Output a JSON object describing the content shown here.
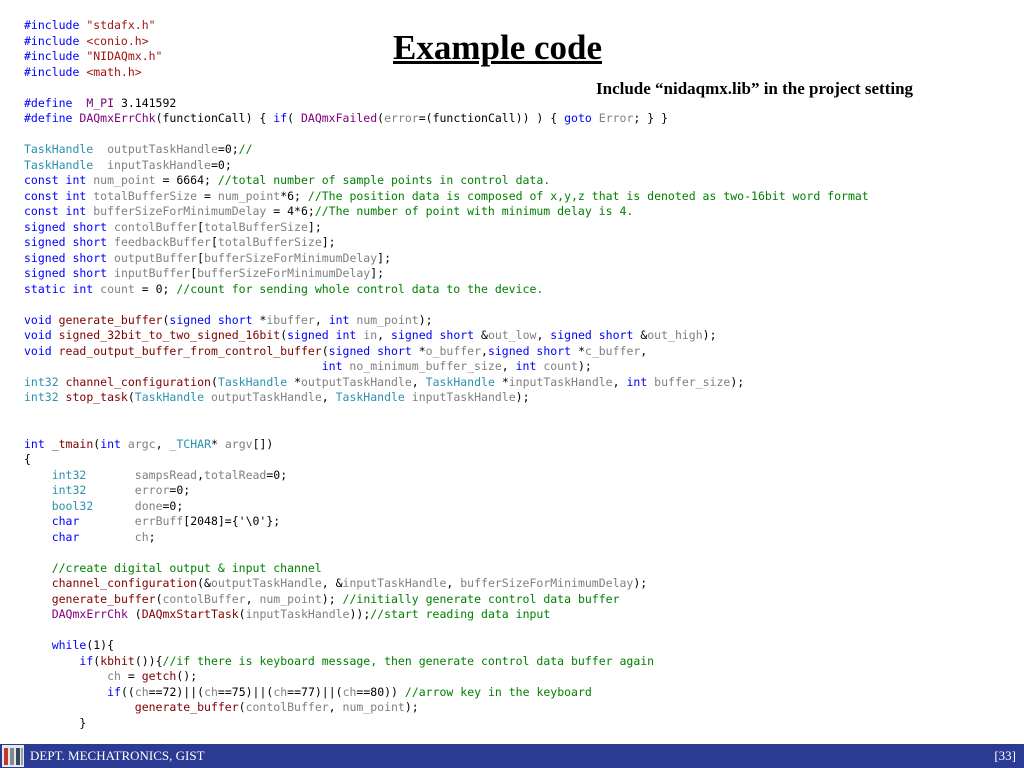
{
  "slide": {
    "title": "Example code",
    "subtitle": "Include “nidaqmx.lib” in the project setting"
  },
  "code": {
    "lines": [
      [
        {
          "t": "#include ",
          "c": "kw"
        },
        {
          "t": "\"stdafx.h\"",
          "c": "str"
        }
      ],
      [
        {
          "t": "#include ",
          "c": "kw"
        },
        {
          "t": "<conio.h>",
          "c": "str"
        }
      ],
      [
        {
          "t": "#include ",
          "c": "kw"
        },
        {
          "t": "\"NIDAQmx.h\"",
          "c": "str"
        }
      ],
      [
        {
          "t": "#include ",
          "c": "kw"
        },
        {
          "t": "<math.h>",
          "c": "str"
        }
      ],
      [],
      [
        {
          "t": "#define  ",
          "c": "kw"
        },
        {
          "t": "M_PI",
          "c": "mac"
        },
        {
          "t": " 3.141592",
          "c": ""
        }
      ],
      [
        {
          "t": "#define ",
          "c": "kw"
        },
        {
          "t": "DAQmxErrChk",
          "c": "mac"
        },
        {
          "t": "(functionCall) { ",
          "c": ""
        },
        {
          "t": "if",
          "c": "kw"
        },
        {
          "t": "( ",
          "c": ""
        },
        {
          "t": "DAQmxFailed",
          "c": "mac"
        },
        {
          "t": "(",
          "c": ""
        },
        {
          "t": "error",
          "c": "vr"
        },
        {
          "t": "=(functionCall)) ) { ",
          "c": ""
        },
        {
          "t": "goto",
          "c": "kw"
        },
        {
          "t": " ",
          "c": ""
        },
        {
          "t": "Error",
          "c": "vr"
        },
        {
          "t": "; } }",
          "c": ""
        }
      ],
      [],
      [
        {
          "t": "TaskHandle",
          "c": "tp"
        },
        {
          "t": "  ",
          "c": ""
        },
        {
          "t": "outputTaskHandle",
          "c": "vr"
        },
        {
          "t": "=0;",
          "c": ""
        },
        {
          "t": "//",
          "c": "cm"
        }
      ],
      [
        {
          "t": "TaskHandle",
          "c": "tp"
        },
        {
          "t": "  ",
          "c": ""
        },
        {
          "t": "inputTaskHandle",
          "c": "vr"
        },
        {
          "t": "=0;",
          "c": ""
        }
      ],
      [
        {
          "t": "const int ",
          "c": "kw"
        },
        {
          "t": "num_point",
          "c": "vr"
        },
        {
          "t": " = 6664; ",
          "c": ""
        },
        {
          "t": "//total number of sample points in control data.",
          "c": "cm"
        }
      ],
      [
        {
          "t": "const int ",
          "c": "kw"
        },
        {
          "t": "totalBufferSize",
          "c": "vr"
        },
        {
          "t": " = ",
          "c": ""
        },
        {
          "t": "num_point",
          "c": "vr"
        },
        {
          "t": "*6; ",
          "c": ""
        },
        {
          "t": "//The position data is composed of x,y,z that is denoted as two-16bit word format",
          "c": "cm"
        }
      ],
      [
        {
          "t": "const int ",
          "c": "kw"
        },
        {
          "t": "bufferSizeForMinimumDelay",
          "c": "vr"
        },
        {
          "t": " = 4*6;",
          "c": ""
        },
        {
          "t": "//The number of point with minimum delay is 4.",
          "c": "cm"
        }
      ],
      [
        {
          "t": "signed short ",
          "c": "kw"
        },
        {
          "t": "contolBuffer",
          "c": "vr"
        },
        {
          "t": "[",
          "c": ""
        },
        {
          "t": "totalBufferSize",
          "c": "vr"
        },
        {
          "t": "];",
          "c": ""
        }
      ],
      [
        {
          "t": "signed short ",
          "c": "kw"
        },
        {
          "t": "feedbackBuffer",
          "c": "vr"
        },
        {
          "t": "[",
          "c": ""
        },
        {
          "t": "totalBufferSize",
          "c": "vr"
        },
        {
          "t": "];",
          "c": ""
        }
      ],
      [
        {
          "t": "signed short ",
          "c": "kw"
        },
        {
          "t": "outputBuffer",
          "c": "vr"
        },
        {
          "t": "[",
          "c": ""
        },
        {
          "t": "bufferSizeForMinimumDelay",
          "c": "vr"
        },
        {
          "t": "];",
          "c": ""
        }
      ],
      [
        {
          "t": "signed short ",
          "c": "kw"
        },
        {
          "t": "inputBuffer",
          "c": "vr"
        },
        {
          "t": "[",
          "c": ""
        },
        {
          "t": "bufferSizeForMinimumDelay",
          "c": "vr"
        },
        {
          "t": "];",
          "c": ""
        }
      ],
      [
        {
          "t": "static int ",
          "c": "kw"
        },
        {
          "t": "count",
          "c": "vr"
        },
        {
          "t": " = 0; ",
          "c": ""
        },
        {
          "t": "//count for sending whole control data to the device.",
          "c": "cm"
        }
      ],
      [],
      [
        {
          "t": "void ",
          "c": "kw"
        },
        {
          "t": "generate_buffer",
          "c": "fn"
        },
        {
          "t": "(",
          "c": ""
        },
        {
          "t": "signed short ",
          "c": "kw"
        },
        {
          "t": "*",
          "c": ""
        },
        {
          "t": "ibuffer",
          "c": "vr"
        },
        {
          "t": ", ",
          "c": ""
        },
        {
          "t": "int ",
          "c": "kw"
        },
        {
          "t": "num_point",
          "c": "vr"
        },
        {
          "t": ");",
          "c": ""
        }
      ],
      [
        {
          "t": "void ",
          "c": "kw"
        },
        {
          "t": "signed_32bit_to_two_signed_16bit",
          "c": "fn"
        },
        {
          "t": "(",
          "c": ""
        },
        {
          "t": "signed int ",
          "c": "kw"
        },
        {
          "t": "in",
          "c": "vr"
        },
        {
          "t": ", ",
          "c": ""
        },
        {
          "t": "signed short ",
          "c": "kw"
        },
        {
          "t": "&",
          "c": ""
        },
        {
          "t": "out_low",
          "c": "vr"
        },
        {
          "t": ", ",
          "c": ""
        },
        {
          "t": "signed short ",
          "c": "kw"
        },
        {
          "t": "&",
          "c": ""
        },
        {
          "t": "out_high",
          "c": "vr"
        },
        {
          "t": ");",
          "c": ""
        }
      ],
      [
        {
          "t": "void ",
          "c": "kw"
        },
        {
          "t": "read_output_buffer_from_control_buffer",
          "c": "fn"
        },
        {
          "t": "(",
          "c": ""
        },
        {
          "t": "signed short ",
          "c": "kw"
        },
        {
          "t": "*",
          "c": ""
        },
        {
          "t": "o_buffer",
          "c": "vr"
        },
        {
          "t": ",",
          "c": ""
        },
        {
          "t": "signed short ",
          "c": "kw"
        },
        {
          "t": "*",
          "c": ""
        },
        {
          "t": "c_buffer",
          "c": "vr"
        },
        {
          "t": ",",
          "c": ""
        }
      ],
      [
        {
          "t": "                                           ",
          "c": ""
        },
        {
          "t": "int ",
          "c": "kw"
        },
        {
          "t": "no_minimum_buffer_size",
          "c": "vr"
        },
        {
          "t": ", ",
          "c": ""
        },
        {
          "t": "int ",
          "c": "kw"
        },
        {
          "t": "count",
          "c": "vr"
        },
        {
          "t": ");",
          "c": ""
        }
      ],
      [
        {
          "t": "int32 ",
          "c": "tp"
        },
        {
          "t": "channel_configuration",
          "c": "fn"
        },
        {
          "t": "(",
          "c": ""
        },
        {
          "t": "TaskHandle ",
          "c": "tp"
        },
        {
          "t": "*",
          "c": ""
        },
        {
          "t": "outputTaskHandle",
          "c": "vr"
        },
        {
          "t": ", ",
          "c": ""
        },
        {
          "t": "TaskHandle ",
          "c": "tp"
        },
        {
          "t": "*",
          "c": ""
        },
        {
          "t": "inputTaskHandle",
          "c": "vr"
        },
        {
          "t": ", ",
          "c": ""
        },
        {
          "t": "int ",
          "c": "kw"
        },
        {
          "t": "buffer_size",
          "c": "vr"
        },
        {
          "t": ");",
          "c": ""
        }
      ],
      [
        {
          "t": "int32 ",
          "c": "tp"
        },
        {
          "t": "stop_task",
          "c": "fn"
        },
        {
          "t": "(",
          "c": ""
        },
        {
          "t": "TaskHandle ",
          "c": "tp"
        },
        {
          "t": "outputTaskHandle",
          "c": "vr"
        },
        {
          "t": ", ",
          "c": ""
        },
        {
          "t": "TaskHandle ",
          "c": "tp"
        },
        {
          "t": "inputTaskHandle",
          "c": "vr"
        },
        {
          "t": ");",
          "c": ""
        }
      ],
      [],
      [],
      [
        {
          "t": "int ",
          "c": "kw"
        },
        {
          "t": "_tmain",
          "c": "fn"
        },
        {
          "t": "(",
          "c": ""
        },
        {
          "t": "int ",
          "c": "kw"
        },
        {
          "t": "argc",
          "c": "vr"
        },
        {
          "t": ", ",
          "c": ""
        },
        {
          "t": "_TCHAR",
          "c": "tp"
        },
        {
          "t": "* ",
          "c": ""
        },
        {
          "t": "argv",
          "c": "vr"
        },
        {
          "t": "[])",
          "c": ""
        }
      ],
      [
        {
          "t": "{",
          "c": ""
        }
      ],
      [
        {
          "t": "    ",
          "c": ""
        },
        {
          "t": "int32",
          "c": "tp"
        },
        {
          "t": "       ",
          "c": ""
        },
        {
          "t": "sampsRead",
          "c": "vr"
        },
        {
          "t": ",",
          "c": ""
        },
        {
          "t": "totalRead",
          "c": "vr"
        },
        {
          "t": "=0;",
          "c": ""
        }
      ],
      [
        {
          "t": "    ",
          "c": ""
        },
        {
          "t": "int32",
          "c": "tp"
        },
        {
          "t": "       ",
          "c": ""
        },
        {
          "t": "error",
          "c": "vr"
        },
        {
          "t": "=0;",
          "c": ""
        }
      ],
      [
        {
          "t": "    ",
          "c": ""
        },
        {
          "t": "bool32",
          "c": "tp"
        },
        {
          "t": "      ",
          "c": ""
        },
        {
          "t": "done",
          "c": "vr"
        },
        {
          "t": "=0;",
          "c": ""
        }
      ],
      [
        {
          "t": "    ",
          "c": ""
        },
        {
          "t": "char",
          "c": "kw"
        },
        {
          "t": "        ",
          "c": ""
        },
        {
          "t": "errBuff",
          "c": "vr"
        },
        {
          "t": "[2048]={'\\0'};",
          "c": ""
        }
      ],
      [
        {
          "t": "    ",
          "c": ""
        },
        {
          "t": "char",
          "c": "kw"
        },
        {
          "t": "        ",
          "c": ""
        },
        {
          "t": "ch",
          "c": "vr"
        },
        {
          "t": ";",
          "c": ""
        }
      ],
      [],
      [
        {
          "t": "    ",
          "c": ""
        },
        {
          "t": "//create digital output & input channel",
          "c": "cm"
        }
      ],
      [
        {
          "t": "    ",
          "c": ""
        },
        {
          "t": "channel_configuration",
          "c": "fn"
        },
        {
          "t": "(&",
          "c": ""
        },
        {
          "t": "outputTaskHandle",
          "c": "vr"
        },
        {
          "t": ", &",
          "c": ""
        },
        {
          "t": "inputTaskHandle",
          "c": "vr"
        },
        {
          "t": ", ",
          "c": ""
        },
        {
          "t": "bufferSizeForMinimumDelay",
          "c": "vr"
        },
        {
          "t": ");",
          "c": ""
        }
      ],
      [
        {
          "t": "    ",
          "c": ""
        },
        {
          "t": "generate_buffer",
          "c": "fn"
        },
        {
          "t": "(",
          "c": ""
        },
        {
          "t": "contolBuffer",
          "c": "vr"
        },
        {
          "t": ", ",
          "c": ""
        },
        {
          "t": "num_point",
          "c": "vr"
        },
        {
          "t": "); ",
          "c": ""
        },
        {
          "t": "//initially generate control data buffer",
          "c": "cm"
        }
      ],
      [
        {
          "t": "    ",
          "c": ""
        },
        {
          "t": "DAQmxErrChk",
          "c": "mac"
        },
        {
          "t": " (",
          "c": ""
        },
        {
          "t": "DAQmxStartTask",
          "c": "fn"
        },
        {
          "t": "(",
          "c": ""
        },
        {
          "t": "inputTaskHandle",
          "c": "vr"
        },
        {
          "t": "));",
          "c": ""
        },
        {
          "t": "//start reading data input",
          "c": "cm"
        }
      ],
      [],
      [
        {
          "t": "    ",
          "c": ""
        },
        {
          "t": "while",
          "c": "kw"
        },
        {
          "t": "(1){",
          "c": ""
        }
      ],
      [
        {
          "t": "        ",
          "c": ""
        },
        {
          "t": "if",
          "c": "kw"
        },
        {
          "t": "(",
          "c": ""
        },
        {
          "t": "kbhit",
          "c": "fn"
        },
        {
          "t": "()){",
          "c": ""
        },
        {
          "t": "//if there is keyboard message, then generate control data buffer again",
          "c": "cm"
        }
      ],
      [
        {
          "t": "            ",
          "c": ""
        },
        {
          "t": "ch",
          "c": "vr"
        },
        {
          "t": " = ",
          "c": ""
        },
        {
          "t": "getch",
          "c": "fn"
        },
        {
          "t": "();",
          "c": ""
        }
      ],
      [
        {
          "t": "            ",
          "c": ""
        },
        {
          "t": "if",
          "c": "kw"
        },
        {
          "t": "((",
          "c": ""
        },
        {
          "t": "ch",
          "c": "vr"
        },
        {
          "t": "==72)||(",
          "c": ""
        },
        {
          "t": "ch",
          "c": "vr"
        },
        {
          "t": "==75)||(",
          "c": ""
        },
        {
          "t": "ch",
          "c": "vr"
        },
        {
          "t": "==77)||(",
          "c": ""
        },
        {
          "t": "ch",
          "c": "vr"
        },
        {
          "t": "==80)) ",
          "c": ""
        },
        {
          "t": "//arrow key in the keyboard",
          "c": "cm"
        }
      ],
      [
        {
          "t": "                ",
          "c": ""
        },
        {
          "t": "generate_buffer",
          "c": "fn"
        },
        {
          "t": "(",
          "c": ""
        },
        {
          "t": "contolBuffer",
          "c": "vr"
        },
        {
          "t": ", ",
          "c": ""
        },
        {
          "t": "num_point",
          "c": "vr"
        },
        {
          "t": ");",
          "c": ""
        }
      ],
      [
        {
          "t": "        }",
          "c": ""
        }
      ]
    ]
  },
  "footer": {
    "department": "DEPT. MECHATRONICS, GIST",
    "page": "[33]",
    "logo_icon": "gist-logo-icon",
    "bar_color": "#2b3b94"
  },
  "colors": {
    "keyword": "#0000ff",
    "string": "#a31515",
    "comment": "#008000",
    "macro": "#800080",
    "function": "#800000",
    "identifier": "#808080",
    "type": "#2b91af"
  }
}
